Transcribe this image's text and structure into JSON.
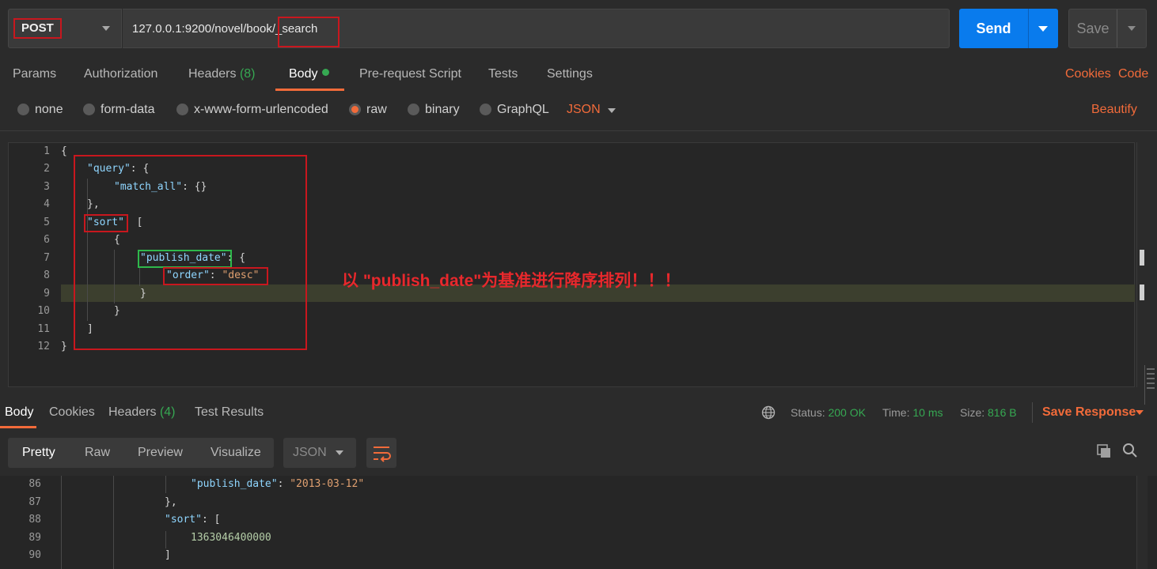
{
  "request": {
    "method": "POST",
    "url": "127.0.0.1:9200/novel/book/_search",
    "send_label": "Send",
    "save_label": "Save"
  },
  "tabs": {
    "params": "Params",
    "authorization": "Authorization",
    "headers": "Headers",
    "headers_count": "(8)",
    "body": "Body",
    "prerequest": "Pre-request Script",
    "tests": "Tests",
    "settings": "Settings",
    "cookies": "Cookies",
    "code": "Code"
  },
  "body_types": {
    "none": "none",
    "form_data": "form-data",
    "urlencoded": "x-www-form-urlencoded",
    "raw": "raw",
    "binary": "binary",
    "graphql": "GraphQL",
    "format": "JSON",
    "beautify": "Beautify",
    "selected": "raw"
  },
  "editor": {
    "line_numbers": [
      "1",
      "2",
      "3",
      "4",
      "5",
      "6",
      "7",
      "8",
      "9",
      "10",
      "11",
      "12"
    ],
    "lines": {
      "l1": "{",
      "l2_key": "\"query\"",
      "l2_rest": ": {",
      "l3_key": "\"match_all\"",
      "l3_rest": ": {}",
      "l4": "},",
      "l5_key": "\"sort\"",
      "l5_rest": ": [",
      "l6": "{",
      "l7_key": "\"publish_date\"",
      "l7_rest": ": {",
      "l8_key": "\"order\"",
      "l8_sep": ": ",
      "l8_val": "\"desc\"",
      "l9": "}",
      "l10": "}",
      "l11": "]",
      "l12": "}"
    },
    "annotation": "以 \"publish_date\"为基准进行降序排列！！！"
  },
  "response": {
    "tabs": {
      "body": "Body",
      "cookies": "Cookies",
      "headers": "Headers",
      "headers_count": "(4)",
      "test_results": "Test Results"
    },
    "status_label": "Status:",
    "status_value": "200 OK",
    "time_label": "Time:",
    "time_value": "10 ms",
    "size_label": "Size:",
    "size_value": "816 B",
    "save_response": "Save Response",
    "views": {
      "pretty": "Pretty",
      "raw": "Raw",
      "preview": "Preview",
      "visualize": "Visualize"
    },
    "format": "JSON",
    "line_numbers": [
      "86",
      "87",
      "88",
      "89",
      "90"
    ],
    "lines": {
      "l86_key": "\"publish_date\"",
      "l86_sep": ": ",
      "l86_val": "\"2013-03-12\"",
      "l87": "},",
      "l88_key": "\"sort\"",
      "l88_rest": ": [",
      "l89": "1363046400000",
      "l90": "]"
    }
  },
  "colors": {
    "accent": "#f26b3a",
    "send": "#097bed",
    "success": "#36a852",
    "highlight_red": "#c8171e",
    "highlight_green": "#2eb84b"
  }
}
